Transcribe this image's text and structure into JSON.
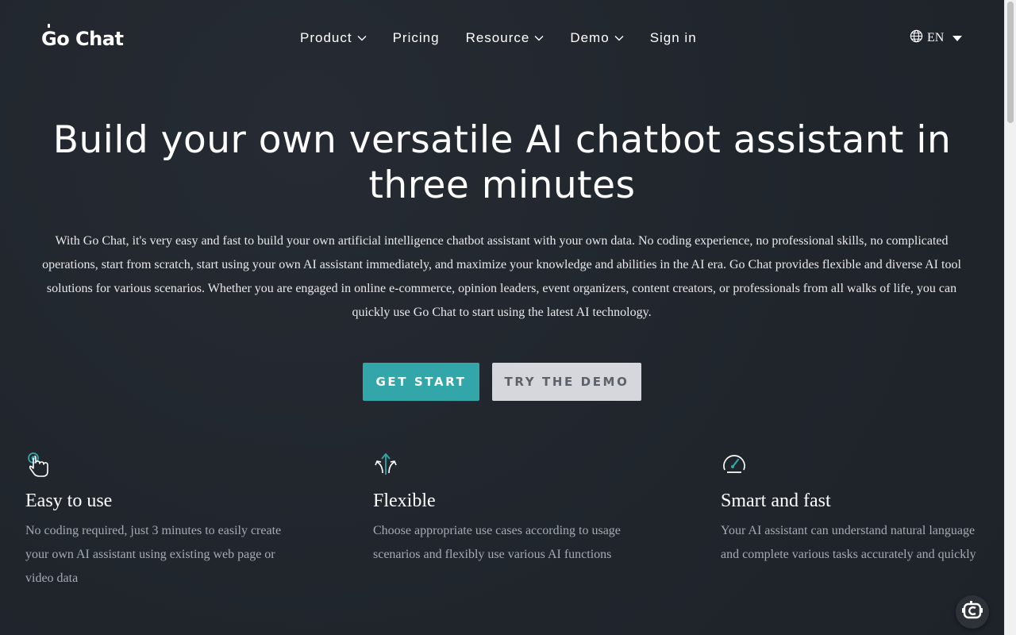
{
  "brand": {
    "name": "Go Chat"
  },
  "nav": {
    "items": [
      {
        "label": "Product",
        "has_dropdown": true
      },
      {
        "label": "Pricing",
        "has_dropdown": false
      },
      {
        "label": "Resource",
        "has_dropdown": true
      },
      {
        "label": "Demo",
        "has_dropdown": true
      },
      {
        "label": "Sign in",
        "has_dropdown": false
      }
    ],
    "language": {
      "label": "EN",
      "icon": "globe-icon"
    }
  },
  "hero": {
    "title": "Build your own versatile AI chatbot assistant in three minutes",
    "description": "With Go Chat, it's very easy and fast to build your own artificial intelligence chatbot assistant with your own data. No coding experience, no professional skills, no complicated operations, start from scratch, start using your own AI assistant immediately, and maximize your knowledge and abilities in the AI era. Go Chat provides flexible and diverse AI tool solutions for various scenarios. Whether you are engaged in online e-commerce, opinion leaders, event organizers, content creators, or professionals from all walks of life, you can quickly use Go Chat to start using the latest AI technology.",
    "primary_button": "GET START",
    "secondary_button": "TRY THE DEMO"
  },
  "features": [
    {
      "icon": "pointer-hand-icon",
      "title": "Easy to use",
      "text": "No coding required, just 3 minutes to easily create your own AI assistant using existing web page or video data"
    },
    {
      "icon": "branching-arrows-icon",
      "title": "Flexible",
      "text": "Choose appropriate use cases according to usage scenarios and flexibly use various AI functions"
    },
    {
      "icon": "speedometer-icon",
      "title": "Smart and fast",
      "text": "Your AI assistant can understand natural language and complete various tasks accurately and quickly"
    }
  ],
  "colors": {
    "background": "#22272e",
    "accent": "#32a6a9",
    "secondary_button_bg": "#d6d7dc",
    "muted_text": "#a6abb3"
  },
  "widgets": {
    "chat_launcher_icon": "chat-bot-icon"
  }
}
